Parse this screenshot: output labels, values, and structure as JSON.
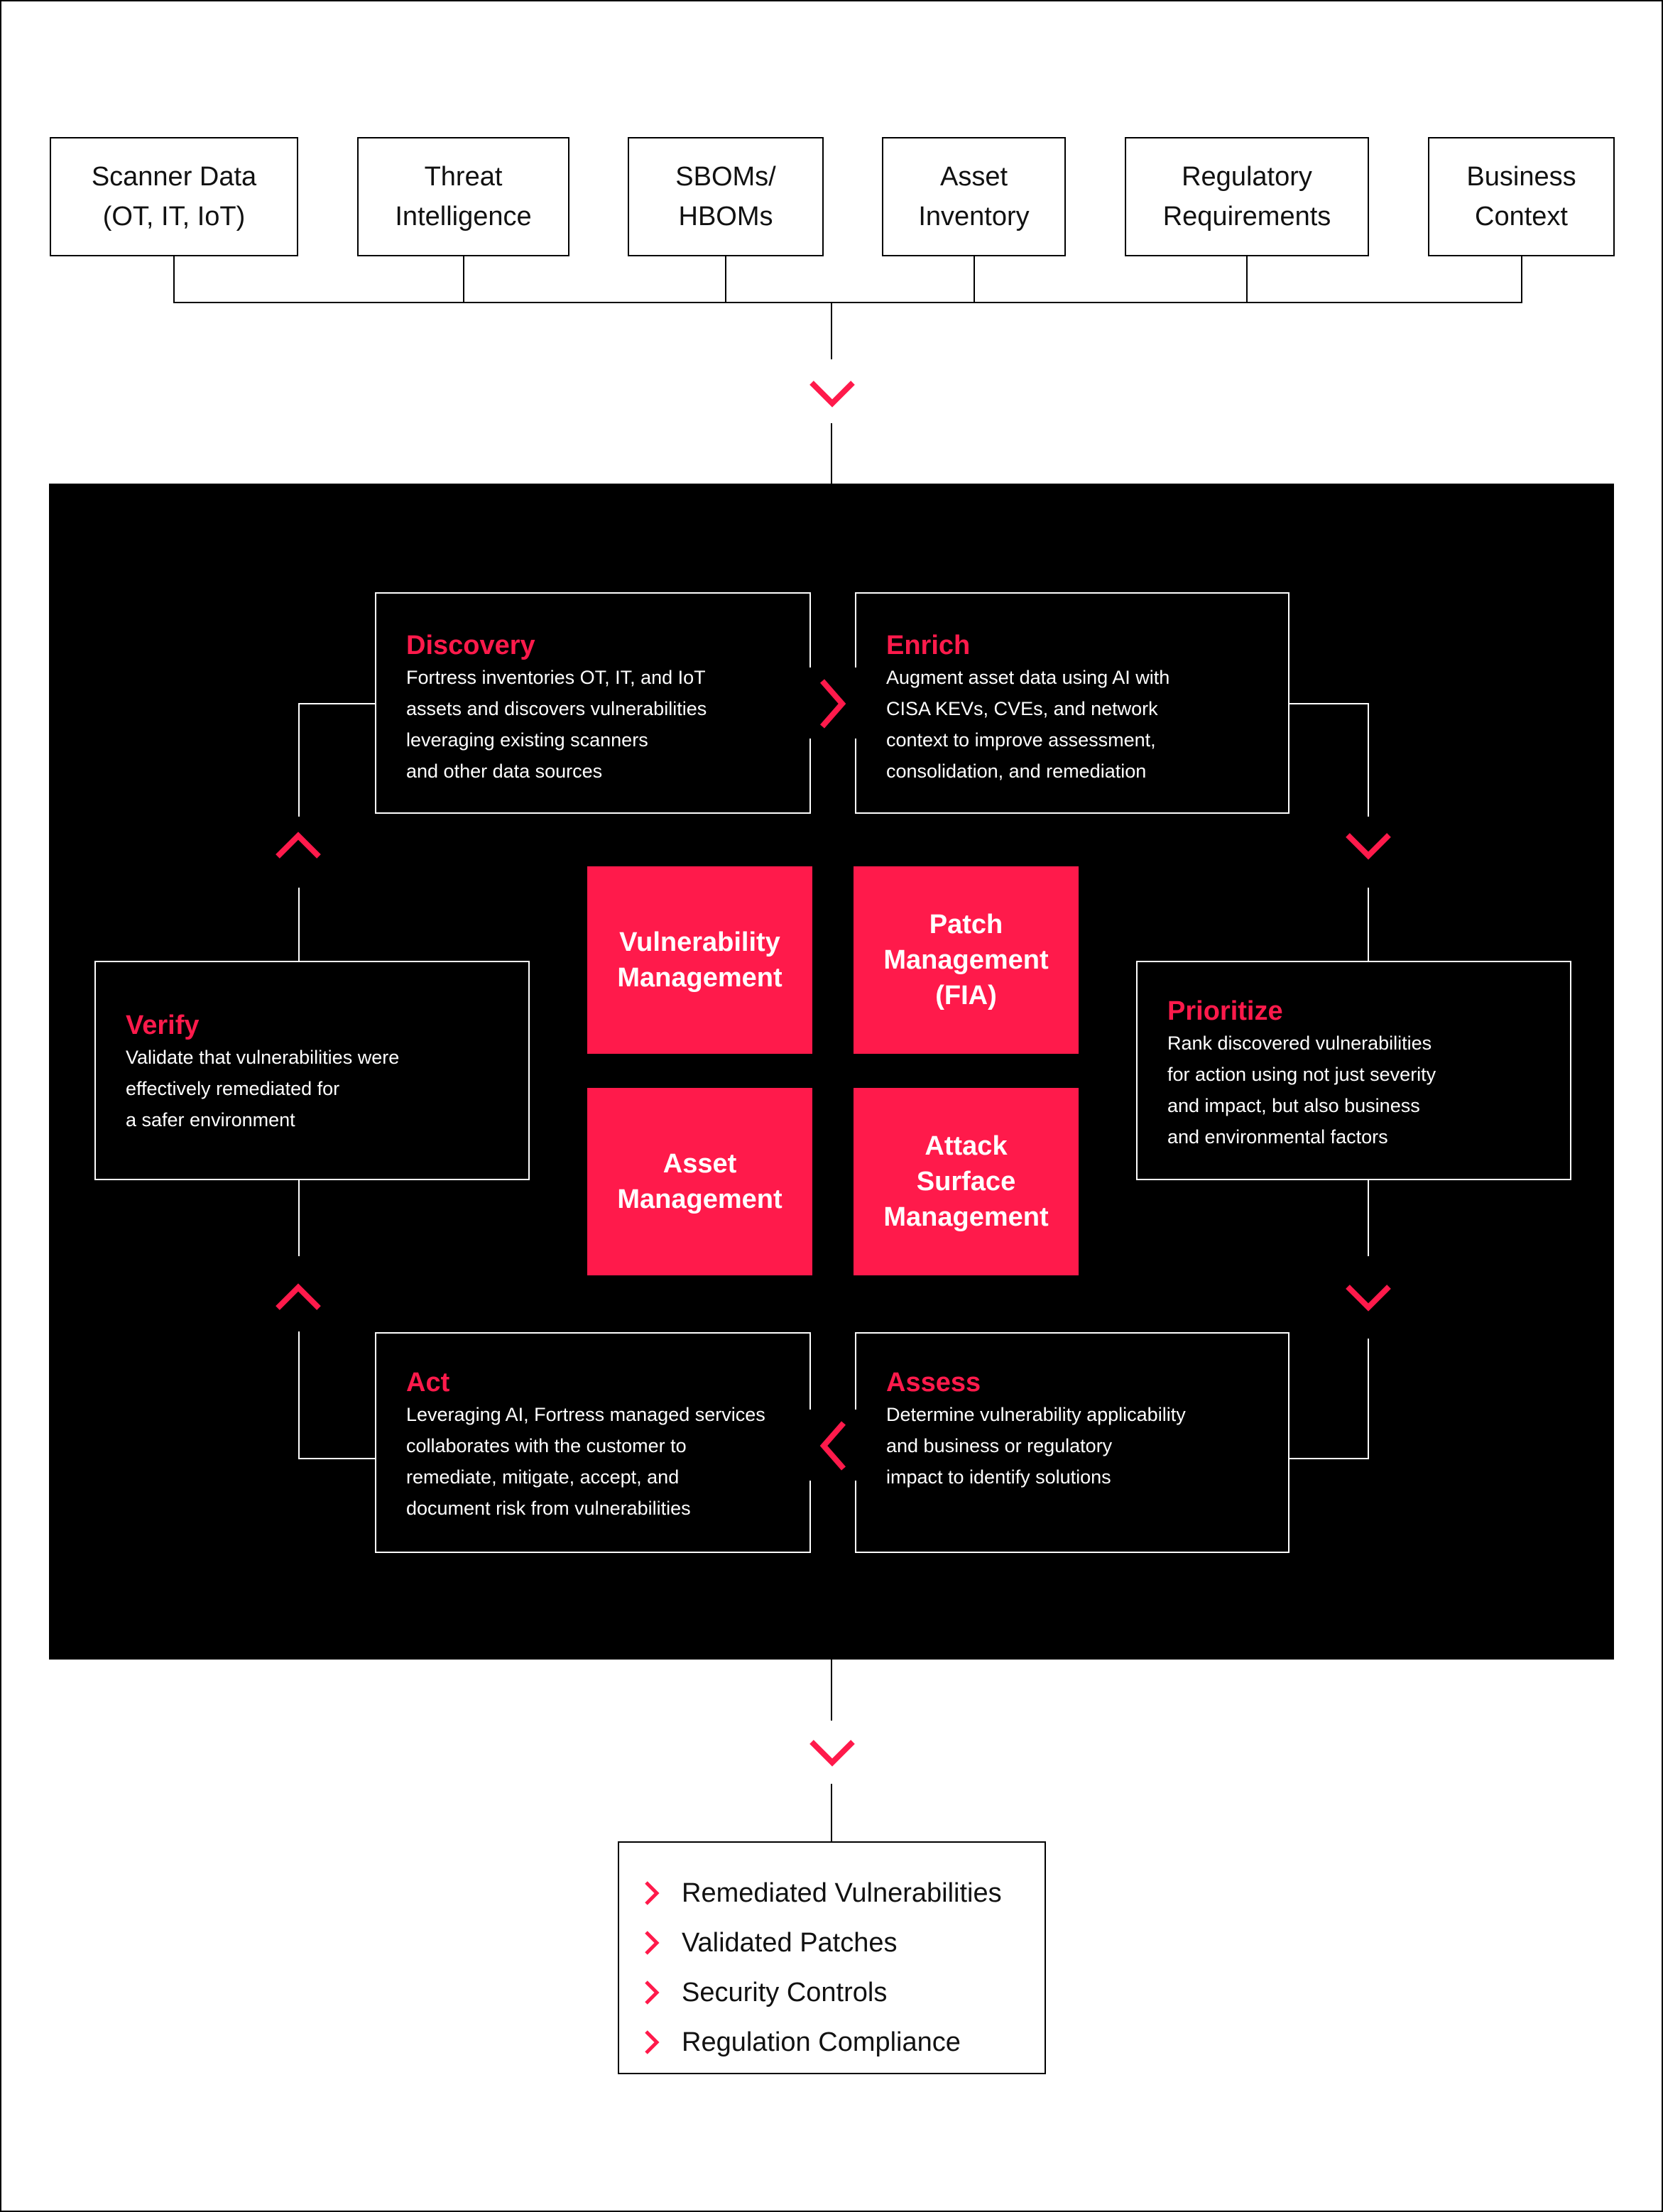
{
  "inputs": [
    {
      "line1": "Scanner Data",
      "line2": "(OT, IT, IoT)"
    },
    {
      "line1": "Threat",
      "line2": "Intelligence"
    },
    {
      "line1": "SBOMs/",
      "line2": "HBOMs"
    },
    {
      "line1": "Asset",
      "line2": "Inventory"
    },
    {
      "line1": "Regulatory",
      "line2": "Requirements"
    },
    {
      "line1": "Business",
      "line2": "Context"
    }
  ],
  "steps": {
    "discovery": {
      "title": "Discovery",
      "text": "Fortress inventories OT, IT, and IoT\nassets and discovers vulnerabilities\nleveraging existing scanners\nand other data sources"
    },
    "enrich": {
      "title": "Enrich",
      "text": "Augment asset data using AI with\nCISA KEVs, CVEs, and network\ncontext to improve assessment,\n consolidation, and remediation"
    },
    "prioritize": {
      "title": "Prioritize",
      "text": "Rank discovered vulnerabilities\nfor action using not just severity\nand impact, but also business\nand environmental factors"
    },
    "assess": {
      "title": "Assess",
      "text": "Determine vulnerability applicability\nand business or regulatory\nimpact to identify solutions"
    },
    "act": {
      "title": "Act",
      "text": "Leveraging AI, Fortress managed services\ncollaborates with the customer to\nremediate, mitigate, accept, and\ndocument risk from vulnerabilities"
    },
    "verify": {
      "title": "Verify",
      "text": "Validate that vulnerabilities were\neffectively remediated for\na safer environment"
    }
  },
  "capabilities": [
    "Vulnerability\nManagement",
    "Patch\nManagement\n(FIA)",
    "Asset\nManagement",
    "Attack\nSurface\nManagement"
  ],
  "outcomes": [
    "Remediated Vulnerabilities",
    "Validated Patches",
    "Security Controls",
    "Regulation Compliance"
  ],
  "colors": {
    "accent": "#ff1a4b",
    "panel": "#000000",
    "background": "#ffffff"
  }
}
